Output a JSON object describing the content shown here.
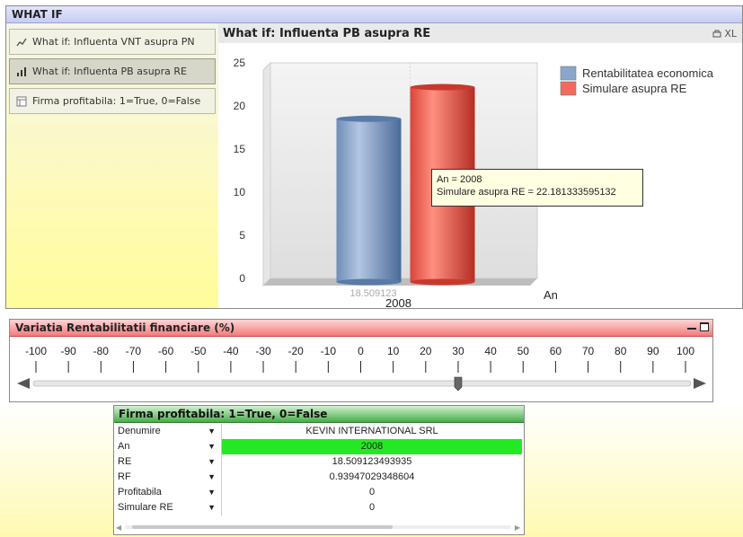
{
  "whatif": {
    "title": "WHAT IF",
    "tabs": [
      {
        "label": "What if: Influenta VNT asupra PN",
        "icon": "line-chart-icon"
      },
      {
        "label": "What if: Influenta PB asupra RE",
        "icon": "bar-chart-icon"
      },
      {
        "label": "Firma profitabila: 1=True, 0=False",
        "icon": "table-icon"
      }
    ],
    "active_tab": 1
  },
  "chart": {
    "title": "What if: Influenta PB asupra RE",
    "xl_label": "XL",
    "tooltip": {
      "line1": "An = 2008",
      "line2": "Simulare asupra RE = 22.181333595132"
    },
    "bar_data_label": "18.509123"
  },
  "chart_data": {
    "type": "bar",
    "categories": [
      "2008"
    ],
    "series": [
      {
        "name": "Rentabilitatea economica",
        "values": [
          18.509123
        ],
        "color": "#87a3c8"
      },
      {
        "name": "Simulare asupra RE",
        "values": [
          22.181333595132
        ],
        "color": "#f0584a"
      }
    ],
    "xlabel": "An",
    "ylabel": "",
    "ylim": [
      0,
      25
    ],
    "yticks": [
      0,
      5,
      10,
      15,
      20,
      25
    ],
    "grid": true,
    "legend": "top-right"
  },
  "slider": {
    "title": "Variatia Rentabilitatii financiare  (%)",
    "ticks": [
      "-100",
      "-90",
      "-80",
      "-70",
      "-60",
      "-50",
      "-40",
      "-30",
      "-20",
      "-10",
      "0",
      "10",
      "20",
      "30",
      "40",
      "50",
      "60",
      "70",
      "80",
      "90",
      "100"
    ],
    "value": 30
  },
  "table": {
    "title": "Firma profitabila: 1=True, 0=False",
    "rows": [
      {
        "name": "Denumire",
        "value": "KEVIN INTERNATIONAL SRL"
      },
      {
        "name": "An",
        "value": "2008"
      },
      {
        "name": "RE",
        "value": "18.509123493935"
      },
      {
        "name": "RF",
        "value": "0.93947029348604"
      },
      {
        "name": "Profitabila",
        "value": "0"
      },
      {
        "name": "Simulare RE",
        "value": "0"
      }
    ],
    "highlight_row": 1
  }
}
